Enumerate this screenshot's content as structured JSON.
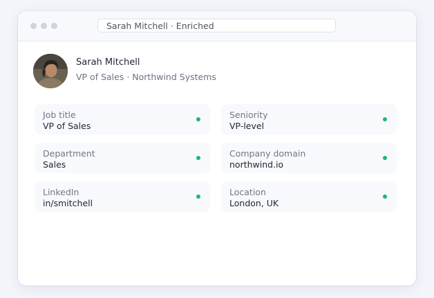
{
  "window": {
    "address_text": "Sarah Mitchell · Enriched"
  },
  "profile": {
    "name": "Sarah Mitchell",
    "subtitle": "VP of Sales · Northwind Systems"
  },
  "fields": [
    {
      "label": "Job title",
      "value": "VP of Sales",
      "status": "verified"
    },
    {
      "label": "Seniority",
      "value": "VP-level",
      "status": "verified"
    },
    {
      "label": "Department",
      "value": "Sales",
      "status": "verified"
    },
    {
      "label": "Company domain",
      "value": "northwind.io",
      "status": "verified"
    },
    {
      "label": "LinkedIn",
      "value": "in/smitchell",
      "status": "verified"
    },
    {
      "label": "Location",
      "value": "London, UK",
      "status": "verified"
    }
  ],
  "colors": {
    "status_verified": "#22b573",
    "background": "#f4f5fb",
    "card": "#ffffff",
    "field_bg": "#f7f9fc"
  }
}
